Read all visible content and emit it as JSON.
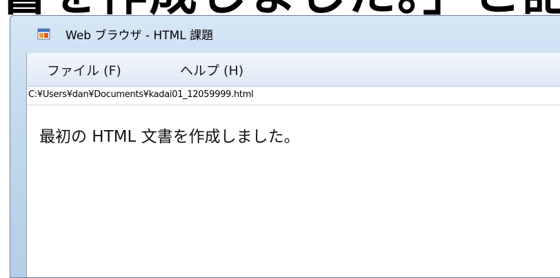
{
  "heading": {
    "text": "書を作成しました。」と記述"
  },
  "window": {
    "title": "Web ブラウザ - HTML 課題",
    "icon": "app-window-icon"
  },
  "menu": {
    "items": [
      {
        "label": "ファイル (F)"
      },
      {
        "label": "ヘルプ (H)"
      }
    ]
  },
  "address": {
    "path": "C:¥Users¥dan¥Documents¥kadai01_12059999.html"
  },
  "content": {
    "text": "最初の HTML 文書を作成しました。"
  },
  "colors": {
    "frame": "#c2d8ee",
    "icon_orange": "#f0a030",
    "icon_blue": "#3a78c8"
  }
}
